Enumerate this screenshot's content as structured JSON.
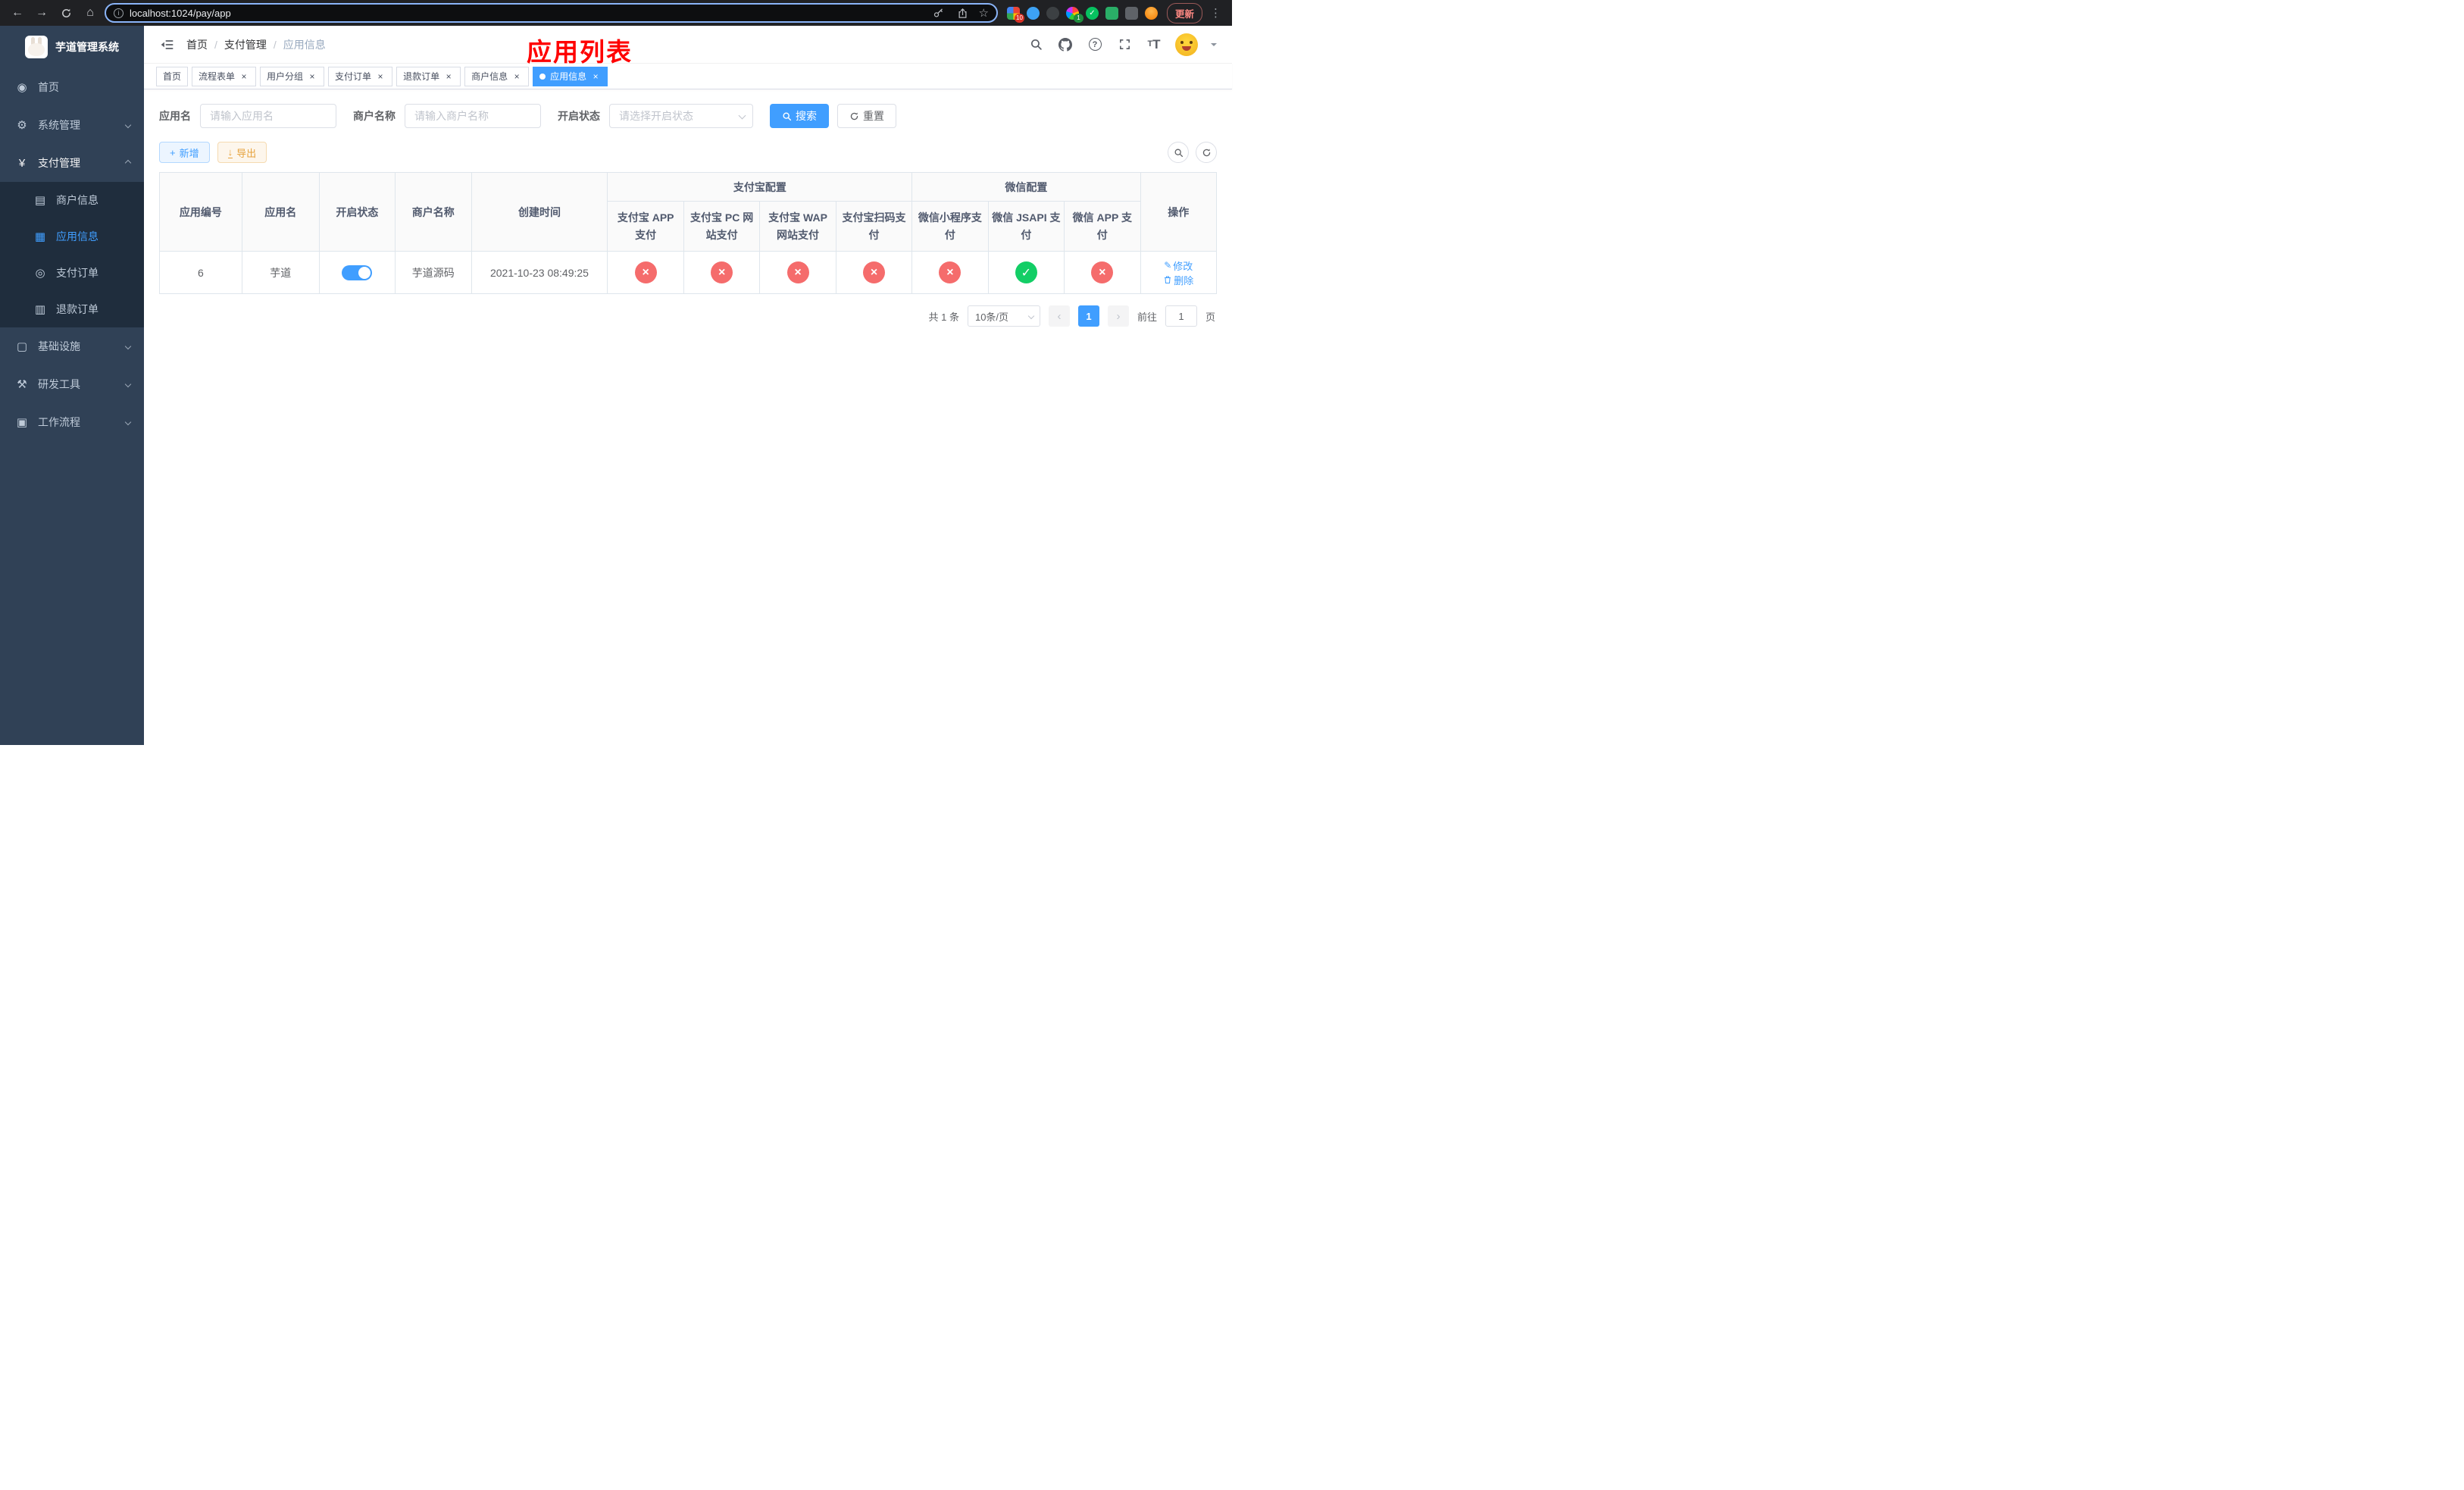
{
  "browser": {
    "url": "localhost:1024/pay/app",
    "update_label": "更新",
    "ext_badge_1": "10",
    "ext_badge_2": "1"
  },
  "sidebar": {
    "title": "芋道管理系统",
    "items": [
      {
        "label": "首页"
      },
      {
        "label": "系统管理"
      },
      {
        "label": "支付管理"
      },
      {
        "label": "基础设施"
      },
      {
        "label": "研发工具"
      },
      {
        "label": "工作流程"
      }
    ],
    "payment_children": [
      {
        "label": "商户信息"
      },
      {
        "label": "应用信息"
      },
      {
        "label": "支付订单"
      },
      {
        "label": "退款订单"
      }
    ]
  },
  "header": {
    "breadcrumb": [
      "首页",
      "支付管理",
      "应用信息"
    ],
    "annotation": "应用列表"
  },
  "tabs": [
    {
      "label": "首页"
    },
    {
      "label": "流程表单"
    },
    {
      "label": "用户分组"
    },
    {
      "label": "支付订单"
    },
    {
      "label": "退款订单"
    },
    {
      "label": "商户信息"
    },
    {
      "label": "应用信息"
    }
  ],
  "filters": {
    "app_name": {
      "label": "应用名",
      "placeholder": "请输入应用名",
      "value": ""
    },
    "merchant": {
      "label": "商户名称",
      "placeholder": "请输入商户名称",
      "value": ""
    },
    "status": {
      "label": "开启状态",
      "placeholder": "请选择开启状态"
    },
    "search_label": "搜索",
    "reset_label": "重置"
  },
  "toolbar": {
    "add_label": "新增",
    "export_label": "导出"
  },
  "table": {
    "col_app_id": "应用编号",
    "col_app_name": "应用名",
    "col_status": "开启状态",
    "col_merchant": "商户名称",
    "col_created": "创建时间",
    "group_alipay": "支付宝配置",
    "group_wechat": "微信配置",
    "col_alipay_app": "支付宝 APP 支付",
    "col_alipay_pc": "支付宝 PC 网站支付",
    "col_alipay_wap": "支付宝 WAP 网站支付",
    "col_alipay_qr": "支付宝扫码支付",
    "col_wx_mini": "微信小程序支付",
    "col_wx_jsapi": "微信 JSAPI 支付",
    "col_wx_app": "微信 APP 支付",
    "col_actions": "操作",
    "row": {
      "id": "6",
      "name": "芋道",
      "enabled": true,
      "merchant": "芋道源码",
      "created": "2021-10-23 08:49:25",
      "statuses": [
        false,
        false,
        false,
        false,
        false,
        true,
        false
      ],
      "edit_label": "修改",
      "delete_label": "删除"
    }
  },
  "pagination": {
    "total": "共 1 条",
    "page_size": "10条/页",
    "page": "1",
    "goto_prefix": "前往",
    "goto_value": "1",
    "goto_suffix": "页"
  },
  "colors": {
    "accent": "#409eff",
    "success": "#13ce66",
    "danger": "#f56c6c",
    "annotation": "#ff0000"
  },
  "icons": {
    "back": "←",
    "forward": "→",
    "home": "⌂",
    "info": "i",
    "star": "☆",
    "more": "⋮",
    "dashboard": "◉",
    "gear": "⚙",
    "yen": "¥",
    "merchant": "▤",
    "app_grid": "▦",
    "order": "◎",
    "refund": "▥",
    "infra": "▢",
    "devtool": "⚒",
    "workflow": "▣",
    "question": "?",
    "close": "×",
    "plus": "+",
    "download": "↓",
    "edit": "✎",
    "check": "✓"
  }
}
